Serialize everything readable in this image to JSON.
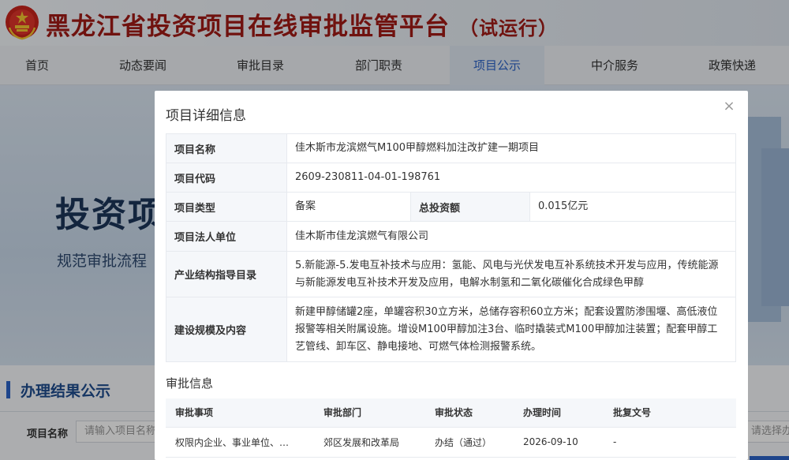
{
  "header": {
    "site_title": "黑龙江省投资项目在线审批监管平台",
    "site_suffix": "（试运行）"
  },
  "nav": {
    "items": [
      "首页",
      "动态要闻",
      "审批目录",
      "部门职责",
      "项目公示",
      "中介服务",
      "政策快递"
    ],
    "active": "项目公示"
  },
  "banner": {
    "title": "投资项",
    "subtitle": "规范审批流程"
  },
  "results": {
    "title": "办理结果公示",
    "filter_label": "项目名称",
    "filter_placeholder": "请输入项目名称",
    "right_placeholder": "请选择办"
  },
  "modal": {
    "title": "项目详细信息",
    "close_glyph": "×",
    "detail": {
      "name_label": "项目名称",
      "name_value": "佳木斯市龙滨燃气M100甲醇燃料加注改扩建一期项目",
      "code_label": "项目代码",
      "code_value": "2609-230811-04-01-198761",
      "type_label": "项目类型",
      "type_value": "备案",
      "invest_label": "总投资额",
      "invest_value": "0.015亿元",
      "entity_label": "项目法人单位",
      "entity_value": "佳木斯市佳龙滨燃气有限公司",
      "industry_label": "产业结构指导目录",
      "industry_value": "5.新能源-5.发电互补技术与应用：氢能、风电与光伏发电互补系统技术开发与应用，传统能源与新能源发电互补技术开发及应用，电解水制氢和二氧化碳催化合成绿色甲醇",
      "scope_label": "建设规模及内容",
      "scope_value": "新建甲醇储罐2座，单罐容积30立方米，总储存容积60立方米；配套设置防渗围堰、高低液位报警等相关附属设施。增设M100甲醇加注3台、临时撬装式M100甲醇加注装置；配套甲醇工艺管线、卸车区、静电接地、可燃气体检测报警系统。"
    },
    "approval": {
      "title": "审批信息",
      "headers": [
        "审批事项",
        "审批部门",
        "审批状态",
        "办理时间",
        "批复文号"
      ],
      "rows": [
        [
          "权限内企业、事业单位、…",
          "郊区发展和改革局",
          "办结（通过）",
          "2026-09-10",
          "-"
        ]
      ]
    }
  }
}
